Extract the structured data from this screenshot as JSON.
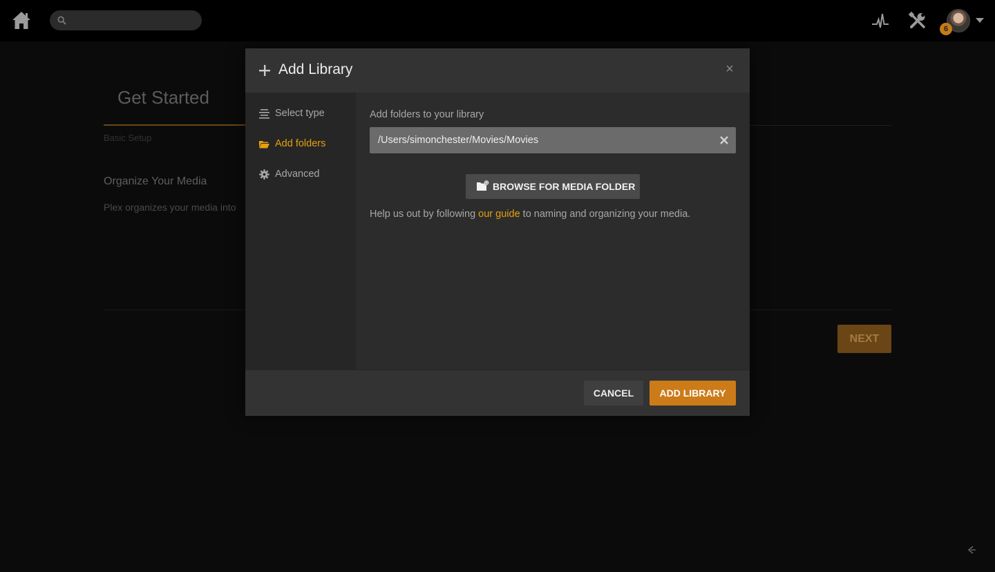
{
  "topbar": {
    "search_placeholder": "",
    "notification_count": "6"
  },
  "background": {
    "title": "Get Started",
    "step": "Basic Setup",
    "heading": "Organize Your Media",
    "paragraph": "Plex organizes your media into",
    "next_label": "NEXT"
  },
  "modal": {
    "title": "Add Library",
    "close_glyph": "×",
    "sidebar": {
      "items": [
        {
          "label": "Select type",
          "icon": "list-icon",
          "active": false
        },
        {
          "label": "Add folders",
          "icon": "folder-icon",
          "active": true
        },
        {
          "label": "Advanced",
          "icon": "gear-icon",
          "active": false
        }
      ]
    },
    "main": {
      "folders_label": "Add folders to your library",
      "folder_path": "/Users/simonchester/Movies/Movies",
      "browse_label": "BROWSE FOR MEDIA FOLDER",
      "help_before": "Help us out by following ",
      "help_link": "our guide",
      "help_after": " to naming and organizing your media."
    },
    "footer": {
      "cancel_label": "CANCEL",
      "add_label": "ADD LIBRARY"
    }
  },
  "colors": {
    "accent": "#e5a00d",
    "primary_button": "#cc7b19"
  }
}
